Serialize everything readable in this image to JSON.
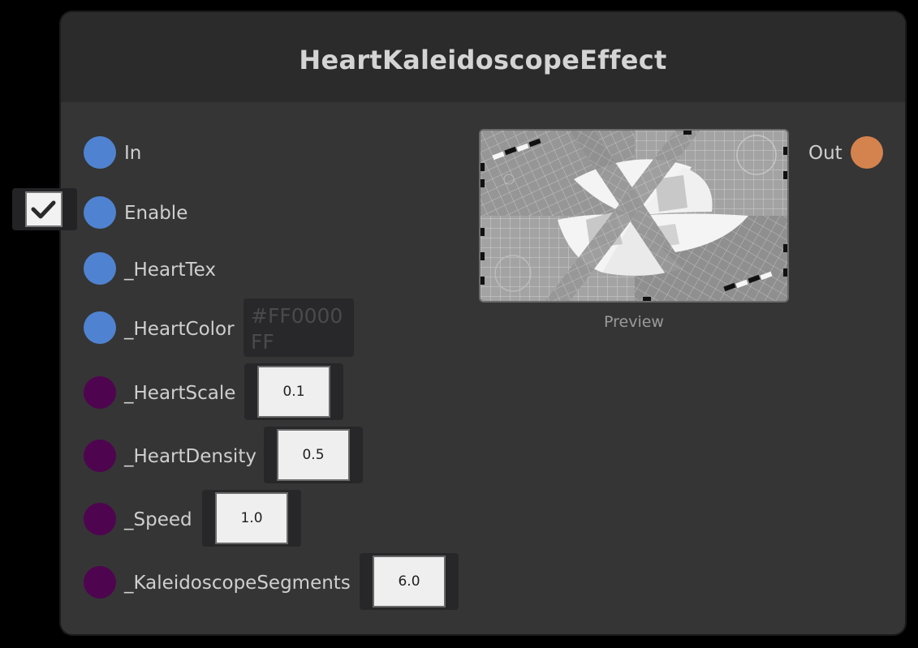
{
  "node": {
    "title": "HeartKaleidoscopeEffect"
  },
  "ports": {
    "in_label": "In",
    "enable_label": "Enable",
    "heart_tex_label": "_HeartTex",
    "heart_color_label": "_HeartColor",
    "heart_scale_label": "_HeartScale",
    "heart_density_label": "_HeartDensity",
    "speed_label": "_Speed",
    "segments_label": "_KaleidoscopeSegments",
    "out_label": "Out"
  },
  "values": {
    "enable_checked": true,
    "heart_color": "#FF0000FF",
    "heart_scale": "0.1",
    "heart_density": "0.5",
    "speed": "1.0",
    "segments": "6.0"
  },
  "preview": {
    "label": "Preview"
  },
  "colors": {
    "port_texture": "#4f83d1",
    "port_float": "#4f0450",
    "port_out": "#d5834e",
    "node_bg": "#353535",
    "header_bg": "#2b2b2b"
  }
}
